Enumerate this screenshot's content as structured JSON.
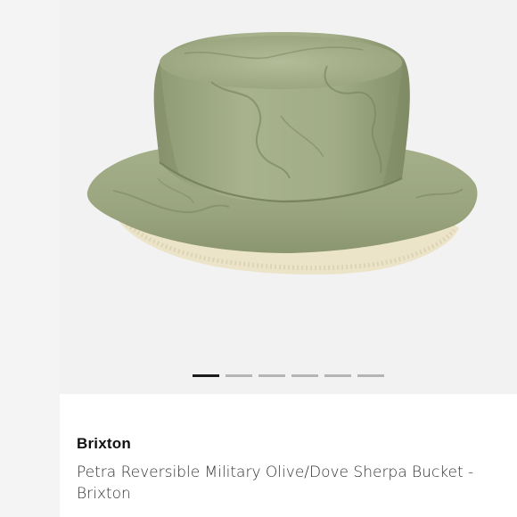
{
  "listing": {
    "brand": "Brixton",
    "title": "Petra Reversible Military Olive/Dove Sherpa Bucket - Brixton"
  },
  "gallery": {
    "image_label": "olive quilted sherpa bucket hat",
    "slide_count": 6,
    "active_slide": 1
  },
  "colors": {
    "hat_olive": "#a5b08a",
    "sherpa_cream": "#ece4c9",
    "active_dot": "#1c1c1c",
    "inactive_dot": "#b5b5b5"
  }
}
